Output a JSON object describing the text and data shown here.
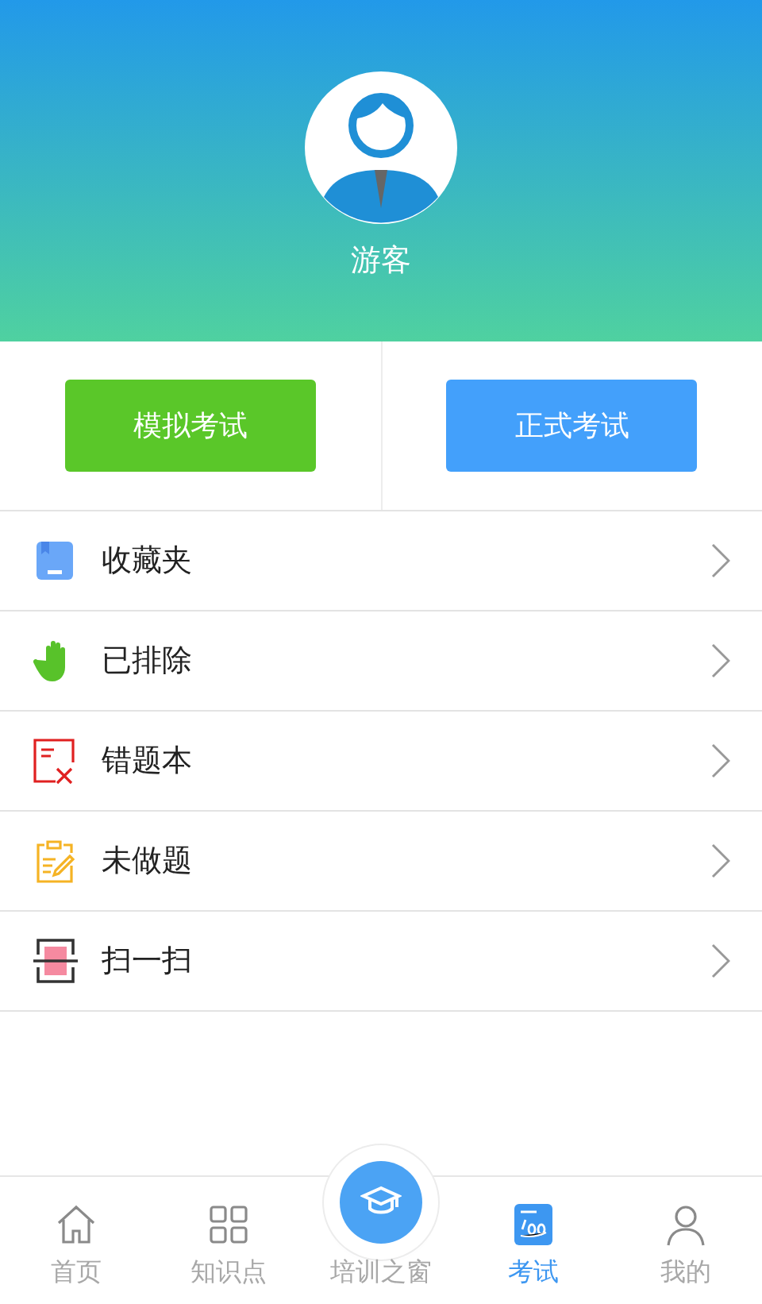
{
  "profile": {
    "name": "游客"
  },
  "exam_buttons": [
    {
      "label": "模拟考试",
      "color": "#5ac729"
    },
    {
      "label": "正式考试",
      "color": "#43a0fb"
    }
  ],
  "menu": [
    {
      "label": "收藏夹",
      "kind": "favorites"
    },
    {
      "label": "已排除",
      "kind": "excluded"
    },
    {
      "label": "错题本",
      "kind": "mistakes"
    },
    {
      "label": "未做题",
      "kind": "undone"
    },
    {
      "label": "扫一扫",
      "kind": "scan"
    }
  ],
  "tabs": [
    {
      "label": "首页",
      "kind": "home",
      "selected": false
    },
    {
      "label": "知识点",
      "kind": "grid",
      "selected": false
    },
    {
      "label": "培训之窗",
      "kind": "center",
      "selected": false
    },
    {
      "label": "考试",
      "kind": "exam",
      "selected": true
    },
    {
      "label": "我的",
      "kind": "person",
      "selected": false
    }
  ]
}
